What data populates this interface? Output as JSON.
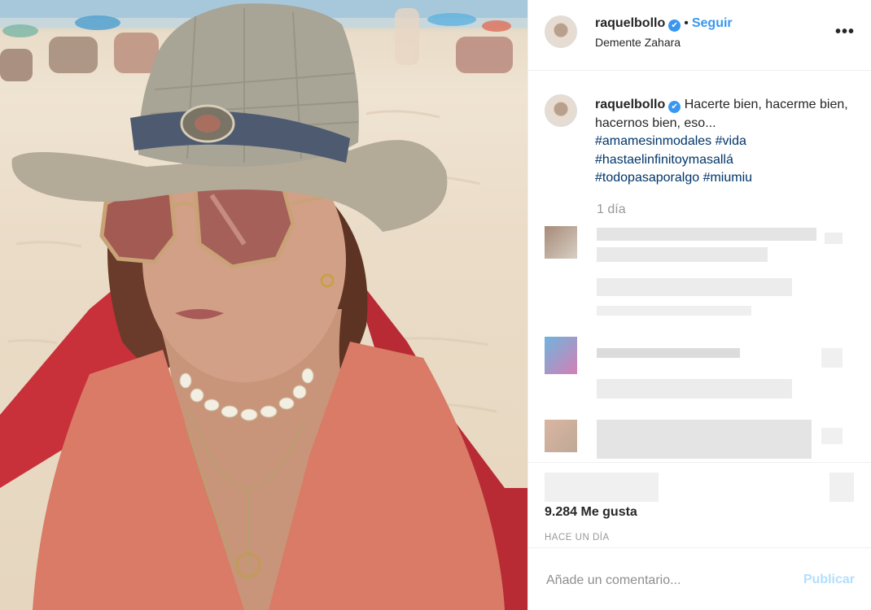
{
  "post": {
    "username": "raquelbollo",
    "verified_mark": "✔",
    "separator": "•",
    "follow_label": "Seguir",
    "location": "Demente Zahara",
    "more_label": "•••"
  },
  "caption": {
    "text": "Hacerte bien, hacerme bien, hacernos bien, eso...",
    "hashtags": [
      "#amamesinmodales",
      "#vida",
      "#hastaelinfinitoymasallá",
      "#todopasaporalgo",
      "#miumiu"
    ],
    "time": "1 día"
  },
  "footer": {
    "likes": "9.284 Me gusta",
    "posted_ago": "HACE UN DÍA",
    "comment_placeholder": "Añade un comentario...",
    "publish_label": "Publicar"
  },
  "colors": {
    "accent": "#3897f0",
    "hashtag": "#003569",
    "publish_disabled": "#b2dffc"
  },
  "icons": {
    "verified": "verified-badge-icon",
    "more": "more-options-icon"
  }
}
